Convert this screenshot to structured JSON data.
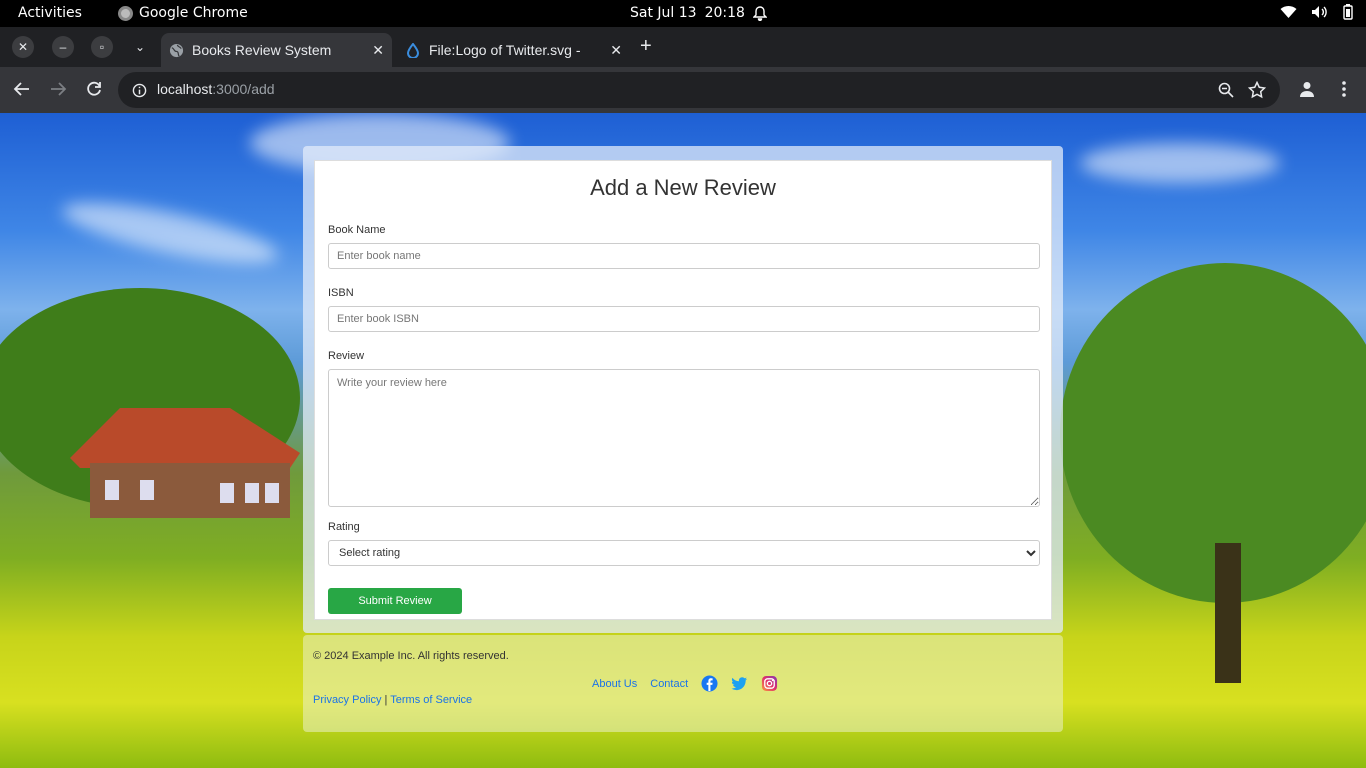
{
  "system": {
    "activities": "Activities",
    "app_name": "Google Chrome",
    "clock_date": "Sat Jul 13",
    "clock_time": "20:18"
  },
  "browser": {
    "tabs": [
      {
        "title": "Books Review System",
        "active": true
      },
      {
        "title": "File:Logo of Twitter.svg -",
        "active": false
      }
    ],
    "url_host": "localhost",
    "url_path": ":3000/add"
  },
  "form": {
    "title": "Add a New Review",
    "book_name_label": "Book Name",
    "book_name_placeholder": "Enter book name",
    "isbn_label": "ISBN",
    "isbn_placeholder": "Enter book ISBN",
    "review_label": "Review",
    "review_placeholder": "Write your review here",
    "rating_label": "Rating",
    "rating_selected": "Select rating",
    "submit_label": "Submit Review"
  },
  "footer": {
    "copyright": "© 2024 Example Inc. All rights reserved.",
    "about": "About Us",
    "contact": "Contact",
    "privacy": "Privacy Policy",
    "separator": "|",
    "terms": "Terms of Service"
  },
  "colors": {
    "submit": "#28a745",
    "link": "#1a73e8",
    "facebook": "#1877f2",
    "twitter": "#1da1f2"
  },
  "icons": [
    "facebook-icon",
    "twitter-icon",
    "instagram-icon"
  ]
}
